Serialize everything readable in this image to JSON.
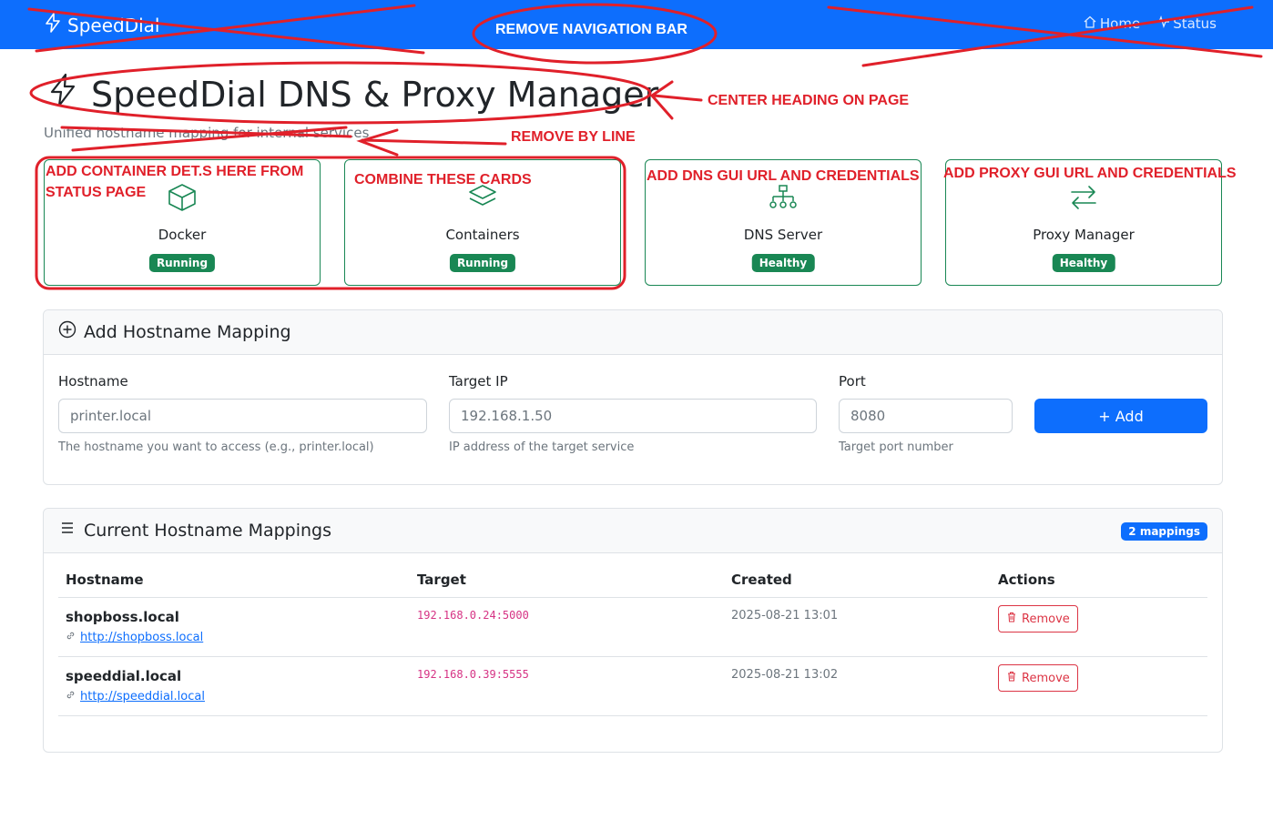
{
  "navbar": {
    "brand": "SpeedDial",
    "links": [
      {
        "label": "Home",
        "icon": "house-icon"
      },
      {
        "label": "Status",
        "icon": "pulse-icon"
      }
    ]
  },
  "header": {
    "title": "SpeedDial DNS & Proxy Manager",
    "subtitle": "Unified hostname mapping for internal services"
  },
  "status_cards": [
    {
      "label": "Docker",
      "status": "Running",
      "icon": "box-icon"
    },
    {
      "label": "Containers",
      "status": "Running",
      "icon": "layers-icon"
    },
    {
      "label": "DNS Server",
      "status": "Healthy",
      "icon": "network-icon"
    },
    {
      "label": "Proxy Manager",
      "status": "Healthy",
      "icon": "arrows-swap-icon"
    }
  ],
  "add_form": {
    "title": "Add Hostname Mapping",
    "hostname": {
      "label": "Hostname",
      "placeholder": "printer.local",
      "help": "The hostname you want to access (e.g., printer.local)"
    },
    "target_ip": {
      "label": "Target IP",
      "placeholder": "192.168.1.50",
      "help": "IP address of the target service"
    },
    "port": {
      "label": "Port",
      "placeholder": "8080",
      "help": "Target port number"
    },
    "add_button": "+ Add"
  },
  "mappings": {
    "title": "Current Hostname Mappings",
    "count_badge": "2 mappings",
    "columns": [
      "Hostname",
      "Target",
      "Created",
      "Actions"
    ],
    "rows": [
      {
        "hostname": "shopboss.local",
        "url": "http://shopboss.local",
        "target": "192.168.0.24:5000",
        "created": "2025-08-21 13:01",
        "action": "Remove"
      },
      {
        "hostname": "speeddial.local",
        "url": "http://speeddial.local",
        "target": "192.168.0.39:5555",
        "created": "2025-08-21 13:02",
        "action": "Remove"
      }
    ]
  },
  "annotations": {
    "remove_nav": "REMOVE NAVIGATION BAR",
    "center_heading": "CENTER HEADING ON PAGE",
    "remove_byline": "REMOVE BY LINE",
    "container_details_1": "ADD CONTAINER DET.S HERE FROM",
    "container_details_2": "STATUS PAGE",
    "combine_cards": "COMBINE THESE CARDS",
    "dns_gui": "ADD DNS GUI URL AND CREDENTIALS",
    "proxy_gui": "ADD PROXY GUI URL AND CREDENTIALS"
  },
  "colors": {
    "primary": "#0d6efd",
    "success": "#198754",
    "danger": "#dc3545",
    "annotation": "#e0202a",
    "code": "#d63384"
  }
}
